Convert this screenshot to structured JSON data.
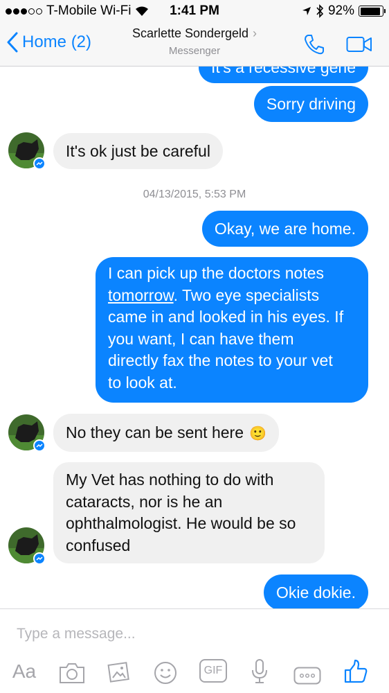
{
  "status_bar": {
    "carrier": "T-Mobile Wi-Fi",
    "time": "1:41 PM",
    "battery": "92%",
    "battery_level": 0.92
  },
  "nav": {
    "back_label": "Home (2)",
    "contact_name": "Scarlette Sondergeld",
    "subtitle": "Messenger"
  },
  "messages": [
    {
      "text": "It's a recessive gene"
    },
    {
      "text": "Sorry driving"
    },
    {
      "text": "It's ok just be careful"
    },
    {
      "timestamp": "04/13/2015, 5:53 PM"
    },
    {
      "text": "Okay, we are home."
    },
    {
      "lines": [
        "I can pick up the doctors notes",
        "tomorrow",
        ". Two eye specialists",
        "came in and looked in his eyes. If",
        "you want, I can have them",
        "directly fax the notes to your vet",
        "to look at."
      ]
    },
    {
      "text": "No they can be sent here",
      "emoji": "🙂"
    },
    {
      "lines": [
        "My Vet has nothing to do with",
        "cataracts, nor is he an",
        "ophthalmologist. He would be so",
        "confused"
      ]
    },
    {
      "text": "Okie dokie."
    }
  ],
  "composer": {
    "placeholder": "Type a message...",
    "toolbar": {
      "aa_label": "Aa",
      "gif_label": "GIF",
      "icons": [
        "camera-icon",
        "gallery-icon",
        "emoji-icon",
        "gif-icon",
        "microphone-icon",
        "more-icon",
        "like-icon"
      ]
    }
  },
  "colors": {
    "accent": "#0b84ff",
    "incoming_bubble": "#f0f0f0",
    "secondary_text": "#8e8e93"
  }
}
